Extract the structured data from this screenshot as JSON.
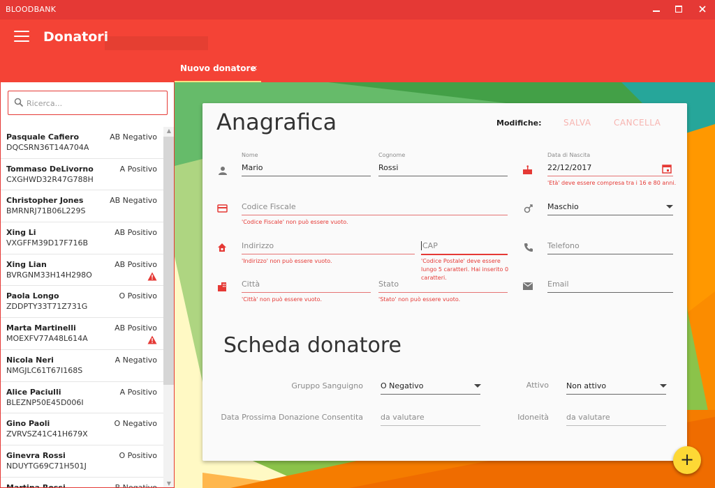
{
  "window": {
    "title": "BLOODBANK",
    "minimize": "▬",
    "maximize": "▢",
    "close": "✕"
  },
  "toolbar": {
    "title": "Donatori"
  },
  "tabs": [
    {
      "label": "Nuovo donatore",
      "close": "×"
    }
  ],
  "search": {
    "placeholder": "Ricerca..."
  },
  "donors": [
    {
      "name": "Pasquale Cafiero",
      "code": "DQCSRN36T14A704A",
      "group": "AB Negativo",
      "warning": false
    },
    {
      "name": "Tommaso DeLivorno",
      "code": "CXGHWD32R47G788H",
      "group": "A Positivo",
      "warning": false
    },
    {
      "name": "Christopher Jones",
      "code": "BMRNRJ71B06L229S",
      "group": "AB Negativo",
      "warning": false
    },
    {
      "name": "Xing Li",
      "code": "VXGFFM39D17F716B",
      "group": "AB Positivo",
      "warning": false
    },
    {
      "name": "Xing Lian",
      "code": "BVRGNM33H14H298O",
      "group": "AB Positivo",
      "warning": true
    },
    {
      "name": "Paola Longo",
      "code": "ZDDPTY33T71Z731G",
      "group": "O Positivo",
      "warning": false
    },
    {
      "name": "Marta Martinelli",
      "code": "MOEXFV77A48L614A",
      "group": "AB Positivo",
      "warning": true
    },
    {
      "name": "Nicola Neri",
      "code": "NMGJLC61T67I168S",
      "group": "A Negativo",
      "warning": false
    },
    {
      "name": "Alice Paciulli",
      "code": "BLEZNP50E45D006I",
      "group": "A Positivo",
      "warning": false
    },
    {
      "name": "Gino Paoli",
      "code": "ZVRVSZ41C41H679X",
      "group": "O Negativo",
      "warning": false
    },
    {
      "name": "Ginevra Rossi",
      "code": "NDUYTG69C71H501J",
      "group": "O Positivo",
      "warning": false
    },
    {
      "name": "Martina Rossi",
      "code": "",
      "group": "B Negativo",
      "warning": false
    }
  ],
  "anagrafica": {
    "title": "Anagrafica",
    "modifiche_label": "Modifiche:",
    "save_label": "SALVA",
    "cancel_label": "CANCELLA",
    "nome": {
      "label": "Nome",
      "value": "Mario"
    },
    "cognome": {
      "label": "Cognome",
      "value": "Rossi"
    },
    "data_nascita": {
      "label": "Data di Nascita",
      "value": "22/12/2017",
      "error": "'Età' deve essere compresa tra i 16 e 80 anni."
    },
    "codice_fiscale": {
      "placeholder": "Codice Fiscale",
      "error": "'Codice Fiscale' non può essere vuoto."
    },
    "sesso": {
      "value": "Maschio"
    },
    "indirizzo": {
      "placeholder": "Indirizzo",
      "error": "'Indirizzo' non può essere vuoto."
    },
    "cap": {
      "placeholder": "CAP",
      "error": "'Codice Postale' deve essere lungo 5 caratteri. Hai inserito 0 caratteri."
    },
    "telefono": {
      "placeholder": "Telefono"
    },
    "citta": {
      "placeholder": "Città",
      "error": "'Città' non può essere vuoto."
    },
    "stato": {
      "placeholder": "Stato",
      "error": "'Stato' non può essere vuoto."
    },
    "email": {
      "placeholder": "Email"
    }
  },
  "scheda": {
    "title": "Scheda donatore",
    "gruppo_label": "Gruppo Sanguigno",
    "gruppo_value": "O Negativo",
    "attivo_label": "Attivo",
    "attivo_value": "Non attivo",
    "prossima_label": "Data Prossima Donazione Consentita",
    "prossima_placeholder": "da valutare",
    "idoneita_label": "Idoneità",
    "idoneita_placeholder": "da valutare"
  },
  "fab": {
    "label": "+"
  },
  "colors": {
    "primary": "#f44336",
    "error": "#e53935",
    "fab": "#fdd835"
  }
}
